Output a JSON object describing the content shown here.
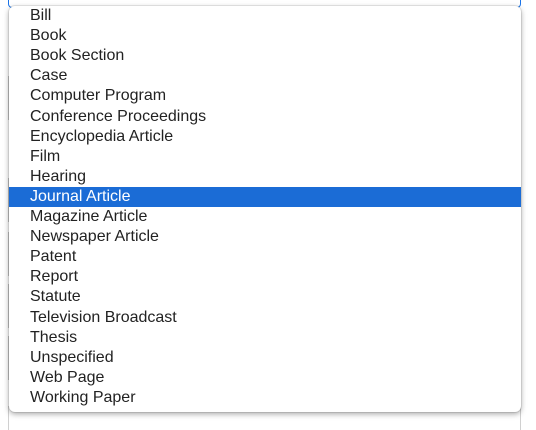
{
  "dropdown": {
    "selected_index": 9,
    "selected_background": "#1b6cd6",
    "options": [
      {
        "label": "Bill"
      },
      {
        "label": "Book"
      },
      {
        "label": "Book Section"
      },
      {
        "label": "Case"
      },
      {
        "label": "Computer Program"
      },
      {
        "label": "Conference Proceedings"
      },
      {
        "label": "Encyclopedia Article"
      },
      {
        "label": "Film"
      },
      {
        "label": "Hearing"
      },
      {
        "label": "Journal Article"
      },
      {
        "label": "Magazine Article"
      },
      {
        "label": "Newspaper Article"
      },
      {
        "label": "Patent"
      },
      {
        "label": "Report"
      },
      {
        "label": "Statute"
      },
      {
        "label": "Television Broadcast"
      },
      {
        "label": "Thesis"
      },
      {
        "label": "Unspecified"
      },
      {
        "label": "Web Page"
      },
      {
        "label": "Working Paper"
      }
    ]
  }
}
